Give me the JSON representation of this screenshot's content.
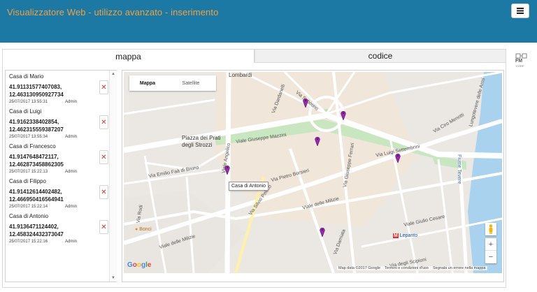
{
  "header": {
    "title": "Visualizzatore Web  - utilizzo avanzato - inserimento",
    "menu_icon": "hamburger-menu-icon"
  },
  "tabs": [
    {
      "label": "mappa",
      "active": true
    },
    {
      "label": "codice",
      "active": false
    }
  ],
  "logo": {
    "text": "FM",
    "subtext": "CORP"
  },
  "locations": [
    {
      "name": "Casa di Mario",
      "coords": "41.91131577407083, 12.463130950927734",
      "date": "25/07/2017 13:55:31",
      "user": "Admin"
    },
    {
      "name": "Casa di Luigi",
      "coords": "41.9162338402854, 12.462315559387207",
      "date": "25/07/2017 13:55:34",
      "user": "Admin"
    },
    {
      "name": "Casa di Francesco",
      "coords": "41.9147648472117, 12.462873458862305",
      "date": "25/07/2017 15:22:13",
      "user": "Admin"
    },
    {
      "name": "Casa di Filippo",
      "coords": "41.91412614402482, 12.466950416564941",
      "date": "25/07/2017 15:22:14",
      "user": "Admin"
    },
    {
      "name": "Casa di Antonio",
      "coords": "41.9136471124402, 12.458324432373047",
      "date": "25/07/2017 15:22:16",
      "user": "Admin"
    }
  ],
  "delete_glyph": "✕",
  "map": {
    "type_control": {
      "map_label": "Mappa",
      "satellite_label": "Satellite",
      "selected": "Mappa"
    },
    "tooltip": "Casa di Antonio",
    "labels": {
      "piazza": "Piazza dei Prati degli Strozzi",
      "lombardi": "Lombardi",
      "fiume": "Fiume Tevere",
      "bonci": "Bonci",
      "lepanto": "Lepanto"
    },
    "streets": {
      "mazzini": "Viale Giuseppe Mazzini",
      "settembrini": "Via Luigi Settembrini",
      "milizie": "Viale delle Milizie",
      "milizie2": "Viale delle Milizie",
      "cesare": "Viale Giulio Cesare",
      "angelico": "Viale Angelico",
      "borsieri": "Via Pietro Borsieri",
      "pellico": "Via Silvio Pellico",
      "faa": "Via Emilio Faà di Bruno",
      "scipioni": "Via degli Scipioni",
      "ferrari": "Via Giuseppe Ferrari",
      "dardanelli": "Via Dardanelli",
      "sabotino": "Via Sabotino",
      "menotti": "Via Ciro Menotti",
      "rodi": "Via Rodi",
      "damiata": "Via Damiata",
      "lungotevere": "Lungotevere delle Armi"
    },
    "google": "Google",
    "attribution": {
      "data": "Map data ©2017 Google",
      "terms": "Termini e condizioni d'uso",
      "report": "Segnala un errore nella mappa"
    },
    "zoom_in": "+",
    "zoom_out": "−"
  },
  "colors": {
    "header_bg": "#1c79a3",
    "title": "#f1a040",
    "delete": "#d9302c",
    "pin": "#9c27b0",
    "park": "#c8e6c0",
    "water": "#a9d2ef"
  }
}
